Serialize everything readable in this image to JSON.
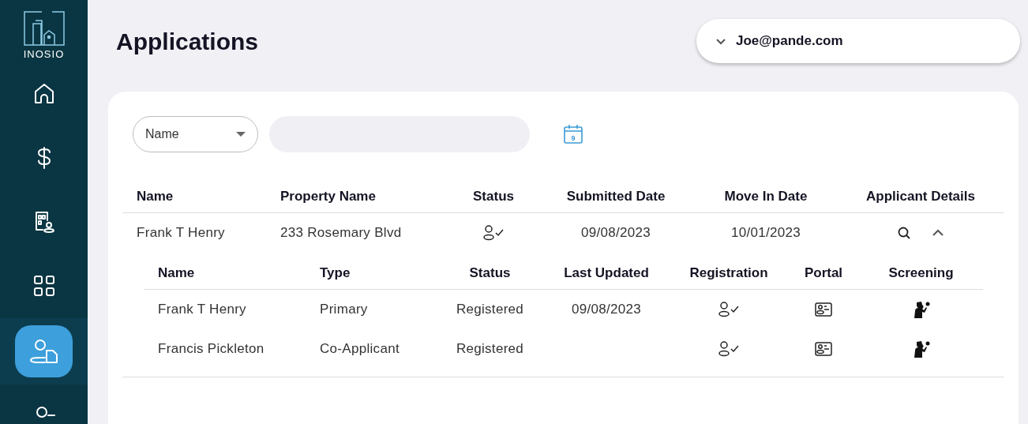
{
  "sidebar": {
    "logo": "INOSIO",
    "items": [
      {
        "kind": "home",
        "selected": false
      },
      {
        "kind": "dollar",
        "selected": false
      },
      {
        "kind": "building",
        "selected": false
      },
      {
        "kind": "grid",
        "selected": false
      },
      {
        "kind": "applications",
        "selected": true
      },
      {
        "kind": "user",
        "selected": false
      }
    ]
  },
  "title": "Applications",
  "user_menu": {
    "label": "Joe@pande.com",
    "expanded": false
  },
  "filter": {
    "field": "Name",
    "calendar_day": "9"
  },
  "table": {
    "columns": [
      "Name",
      "Property Name",
      "Status",
      "Submitted Date",
      "Move In Date",
      "Applicant Details"
    ],
    "rows": [
      {
        "name": "Frank T Henry",
        "property": "233 Rosemary Blvd",
        "registered": true,
        "submitted": "09/08/2023",
        "move_in": "10/01/2023",
        "expanded": true,
        "applicants": {
          "columns": [
            "Name",
            "Type",
            "Status",
            "Last Updated",
            "Registration",
            "Portal",
            "Screening"
          ],
          "rows": [
            {
              "name": "Frank T Henry",
              "type": "Primary",
              "status": "Registered",
              "updated": "09/08/2023",
              "registration_complete": true
            },
            {
              "name": "Francis Pickleton",
              "type": "Co-Applicant",
              "status": "Registered",
              "registration_complete": true
            }
          ]
        }
      }
    ]
  }
}
